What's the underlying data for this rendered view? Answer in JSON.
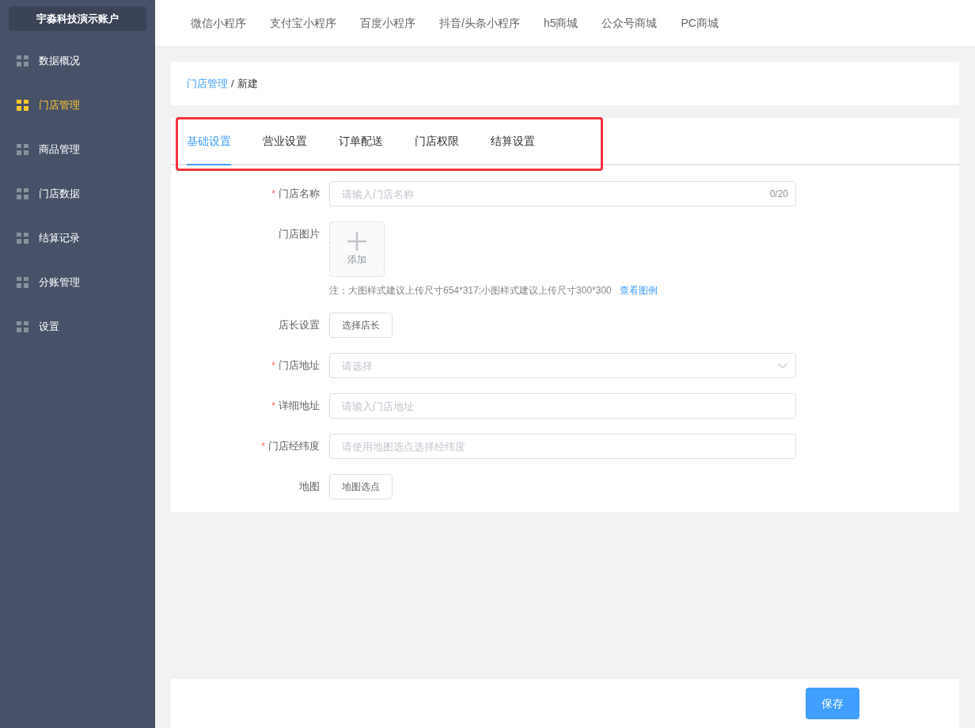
{
  "sidebar": {
    "account": "宇淼科技演示账户",
    "items": [
      {
        "label": "数据概况",
        "selected": false
      },
      {
        "label": "门店管理",
        "selected": true
      },
      {
        "label": "商品管理",
        "selected": false
      },
      {
        "label": "门店数据",
        "selected": false
      },
      {
        "label": "结算记录",
        "selected": false
      },
      {
        "label": "分账管理",
        "selected": false
      },
      {
        "label": "设置",
        "selected": false
      }
    ]
  },
  "top_nav": [
    "微信小程序",
    "支付宝小程序",
    "百度小程序",
    "抖音/头条小程序",
    "h5商城",
    "公众号商城",
    "PC商城"
  ],
  "breadcrumb": {
    "link": "门店管理",
    "separator": "/",
    "current": "新建"
  },
  "tabs": [
    {
      "label": "基础设置",
      "selected": true
    },
    {
      "label": "营业设置",
      "selected": false
    },
    {
      "label": "订单配送",
      "selected": false
    },
    {
      "label": "门店权限",
      "selected": false
    },
    {
      "label": "结算设置",
      "selected": false
    }
  ],
  "form": [
    {
      "kind": "text",
      "label": "门店名称",
      "required_mark": "*",
      "placeholder": "请输入门店名称",
      "counter": "0/20"
    },
    {
      "kind": "upload",
      "label": "门店图片",
      "button": "添加",
      "note": "注：大图样式建议上传尺寸654*317;小图样式建议上传尺寸300*300",
      "note_link": "查看图例"
    },
    {
      "kind": "button",
      "label": "店长设置",
      "button": "选择店长"
    },
    {
      "kind": "select",
      "label": "门店地址",
      "required_mark": "*",
      "placeholder": "请选择"
    },
    {
      "kind": "text",
      "label": "详细地址",
      "required_mark": "*",
      "placeholder": "请输入门店地址"
    },
    {
      "kind": "text",
      "label": "门店经纬度",
      "required_mark": "*",
      "placeholder": "请使用地图选点选择经纬度"
    },
    {
      "kind": "button",
      "label": "地图",
      "button": "地图选点"
    }
  ],
  "save_button": "保存"
}
